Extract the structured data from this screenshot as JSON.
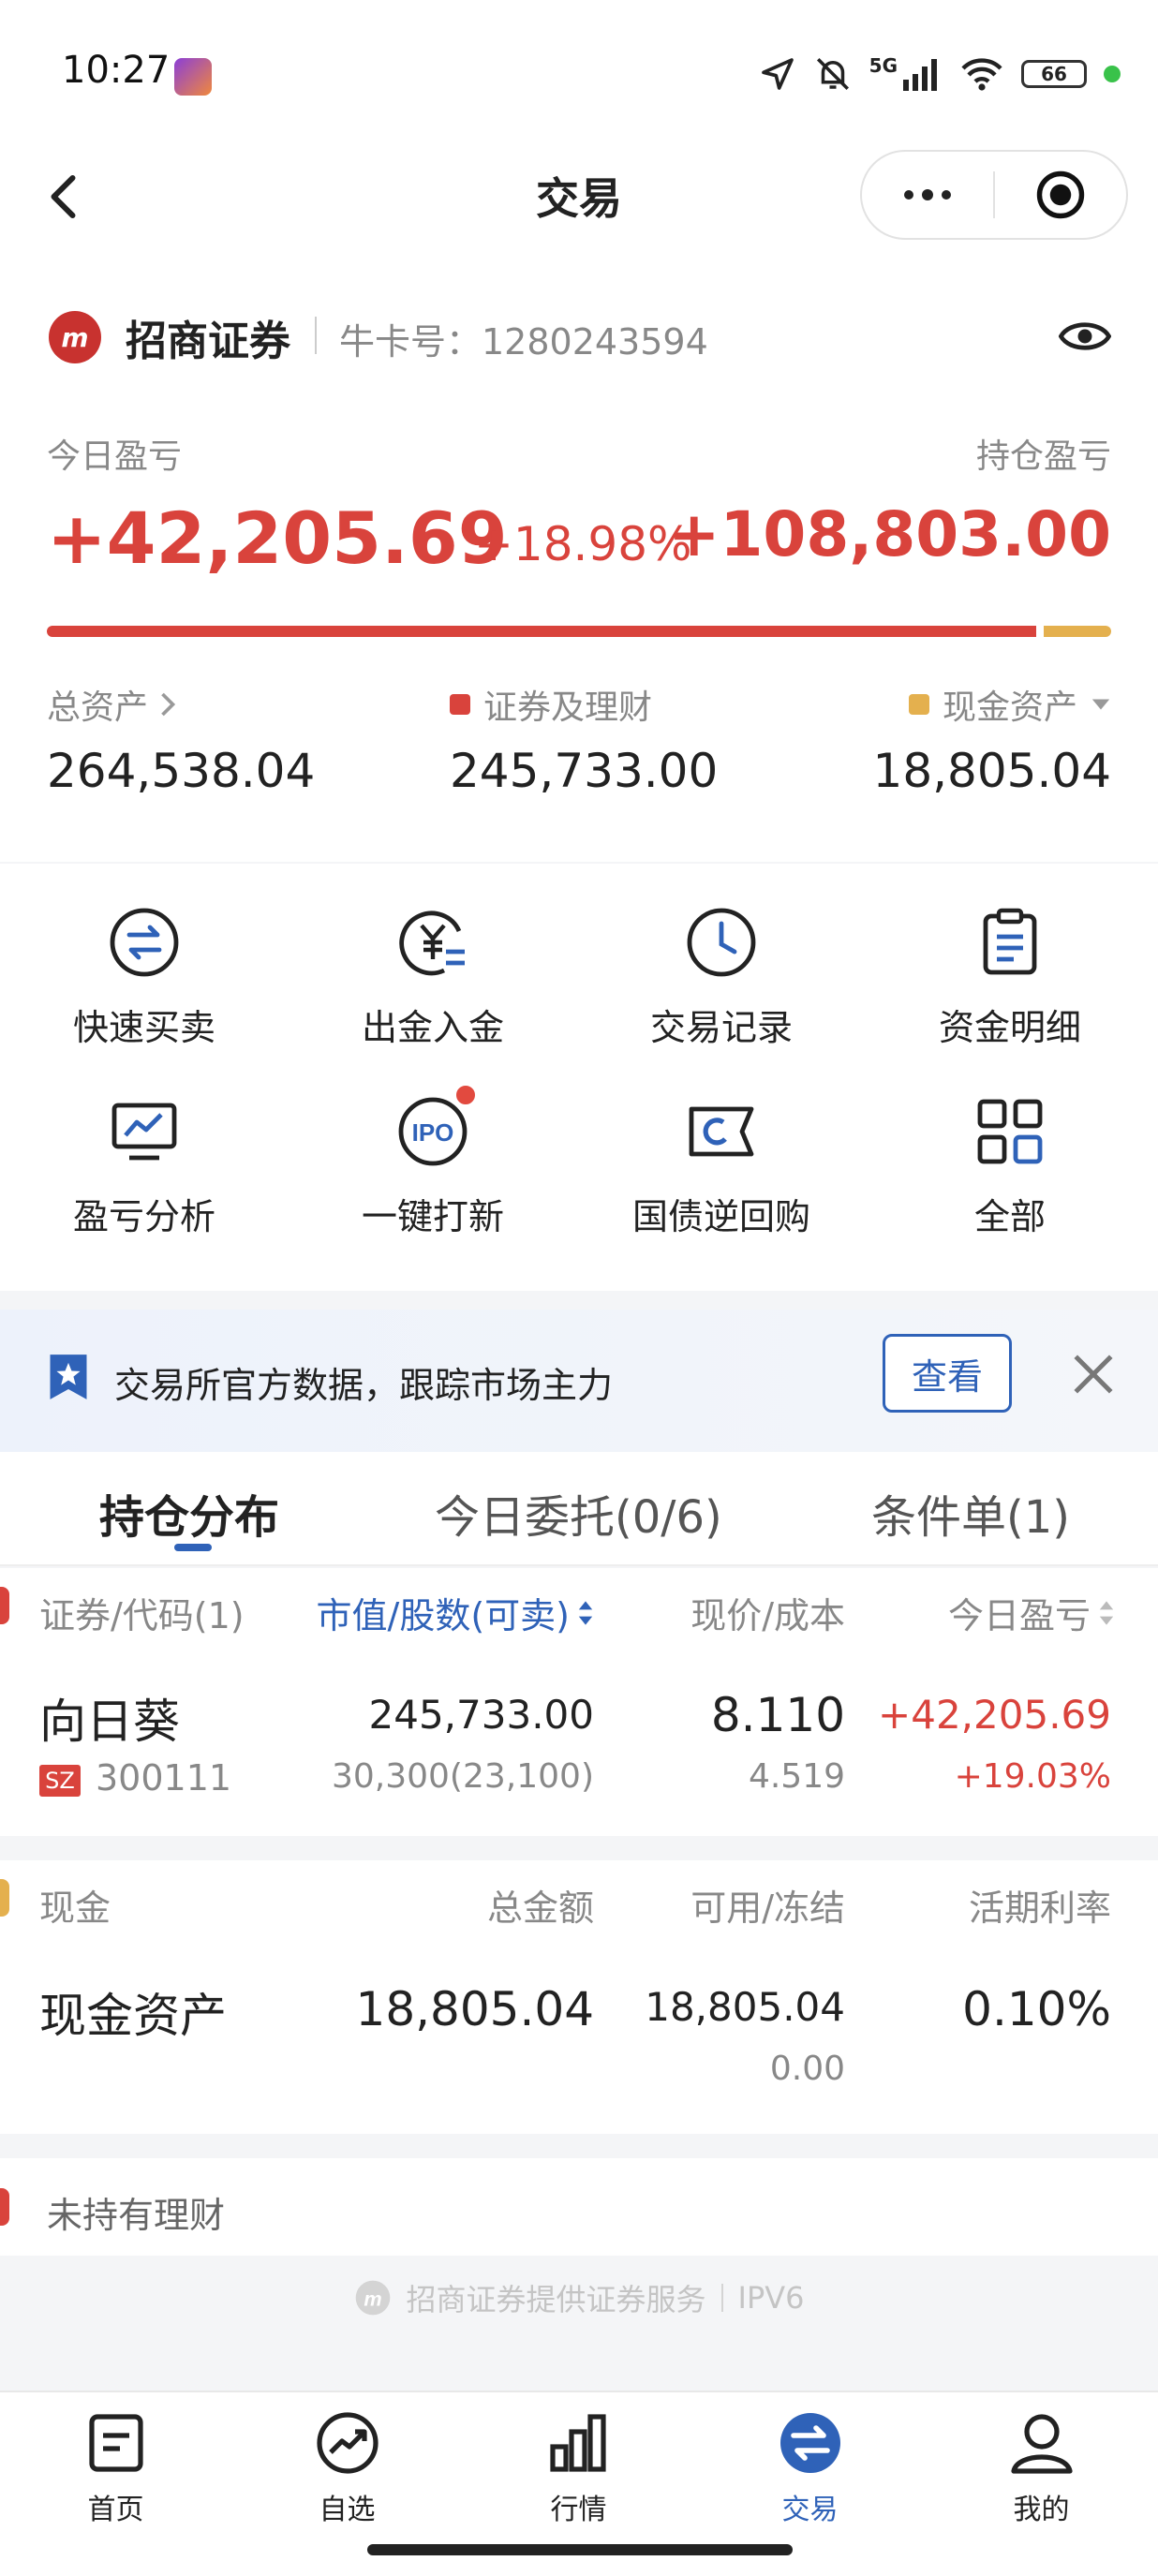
{
  "status_bar": {
    "time": "10:27",
    "network": "5G",
    "battery": "66"
  },
  "header": {
    "title": "交易"
  },
  "account": {
    "broker_name": "招商证券",
    "account_label": "牛卡号：1280243594",
    "today_pl_label": "今日盈亏",
    "today_pl_value": "+42,205.69",
    "today_pl_pct": "+18.98%",
    "hold_pl_label": "持仓盈亏",
    "hold_pl_value": "+108,803.00",
    "securities_share": 0.93,
    "total_assets_label": "总资产",
    "total_assets_value": "264,538.04",
    "securities_label": "证券及理财",
    "securities_value": "245,733.00",
    "cash_label": "现金资产",
    "cash_value": "18,805.04"
  },
  "quick_menu": [
    {
      "label": "快速买卖",
      "icon": "swap-circle-icon"
    },
    {
      "label": "出金入金",
      "icon": "yuan-transfer-icon"
    },
    {
      "label": "交易记录",
      "icon": "clock-icon"
    },
    {
      "label": "资金明细",
      "icon": "clipboard-icon"
    },
    {
      "label": "盈亏分析",
      "icon": "chart-monitor-icon"
    },
    {
      "label": "一键打新",
      "icon": "ipo-icon"
    },
    {
      "label": "国债逆回购",
      "icon": "ticket-icon"
    },
    {
      "label": "全部",
      "icon": "grid-icon"
    }
  ],
  "banner": {
    "text": "交易所官方数据，跟踪市场主力",
    "button": "查看"
  },
  "tabs": [
    {
      "label": "持仓分布",
      "active": true
    },
    {
      "label": "今日委托(0/6)",
      "active": false
    },
    {
      "label": "条件单(1)",
      "active": false
    }
  ],
  "holdings": {
    "headers": [
      "证券/代码(1)",
      "市值/股数(可卖)",
      "现价/成本",
      "今日盈亏"
    ],
    "rows": [
      {
        "name": "向日葵",
        "market": "SZ",
        "code": "300111",
        "market_value": "245,733.00",
        "shares": "30,300(23,100)",
        "price": "8.110",
        "cost": "4.519",
        "today_pl": "+42,205.69",
        "today_pl_pct": "+19.03%"
      }
    ]
  },
  "cash": {
    "headers": [
      "现金",
      "总金额",
      "可用/冻结",
      "活期利率"
    ],
    "row": {
      "name": "现金资产",
      "total": "18,805.04",
      "available": "18,805.04",
      "frozen": "0.00",
      "rate": "0.10%"
    }
  },
  "not_held": {
    "label": "未持有理财"
  },
  "footer": {
    "note": "招商证券提供证券服务",
    "tag": "IPV6"
  },
  "bottom_nav": [
    {
      "label": "首页",
      "active": false
    },
    {
      "label": "自选",
      "active": false
    },
    {
      "label": "行情",
      "active": false
    },
    {
      "label": "交易",
      "active": true
    },
    {
      "label": "我的",
      "active": false
    }
  ],
  "colors": {
    "accent_blue": "#2f62b8",
    "gain_red": "#d9433c",
    "cash_gold": "#e4b04e"
  }
}
